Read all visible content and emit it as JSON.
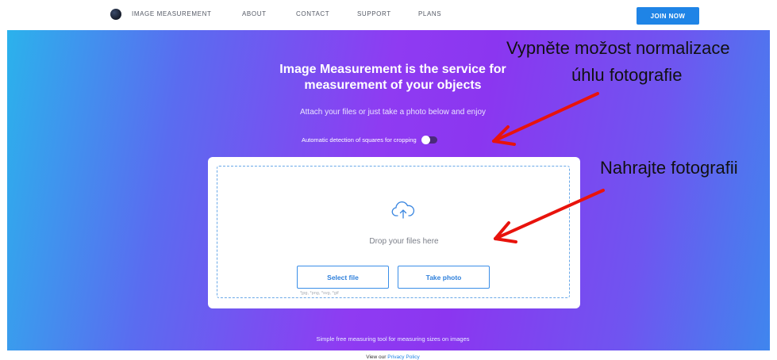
{
  "nav": {
    "brand": "IMAGE MEASUREMENT",
    "items": [
      "ABOUT",
      "CONTACT",
      "SUPPORT",
      "PLANS"
    ],
    "join_label": "JOIN NOW"
  },
  "hero": {
    "title_line1": "Image Measurement is the service for",
    "title_line2": "measurement of your objects",
    "subtitle": "Attach your files or just take a photo below and enjoy",
    "auto_detect_label": "Automatic detection of squares for cropping"
  },
  "upload": {
    "drop_text": "Drop your files here",
    "select_label": "Select file",
    "take_label": "Take photo",
    "formats": "*jpg, *png, *svg, *gif"
  },
  "footer": {
    "tagline": "Simple free measuring tool for measuring sizes on images",
    "privacy_prefix": "View our",
    "privacy_link": "Privacy Policy"
  },
  "annotations": {
    "line1": "Vypněte možost normalizace",
    "line2": "úhlu fotografie",
    "line3": "Nahrajte fotografii"
  },
  "colors": {
    "accent": "#1f84e6",
    "arrow": "#e8130c"
  }
}
